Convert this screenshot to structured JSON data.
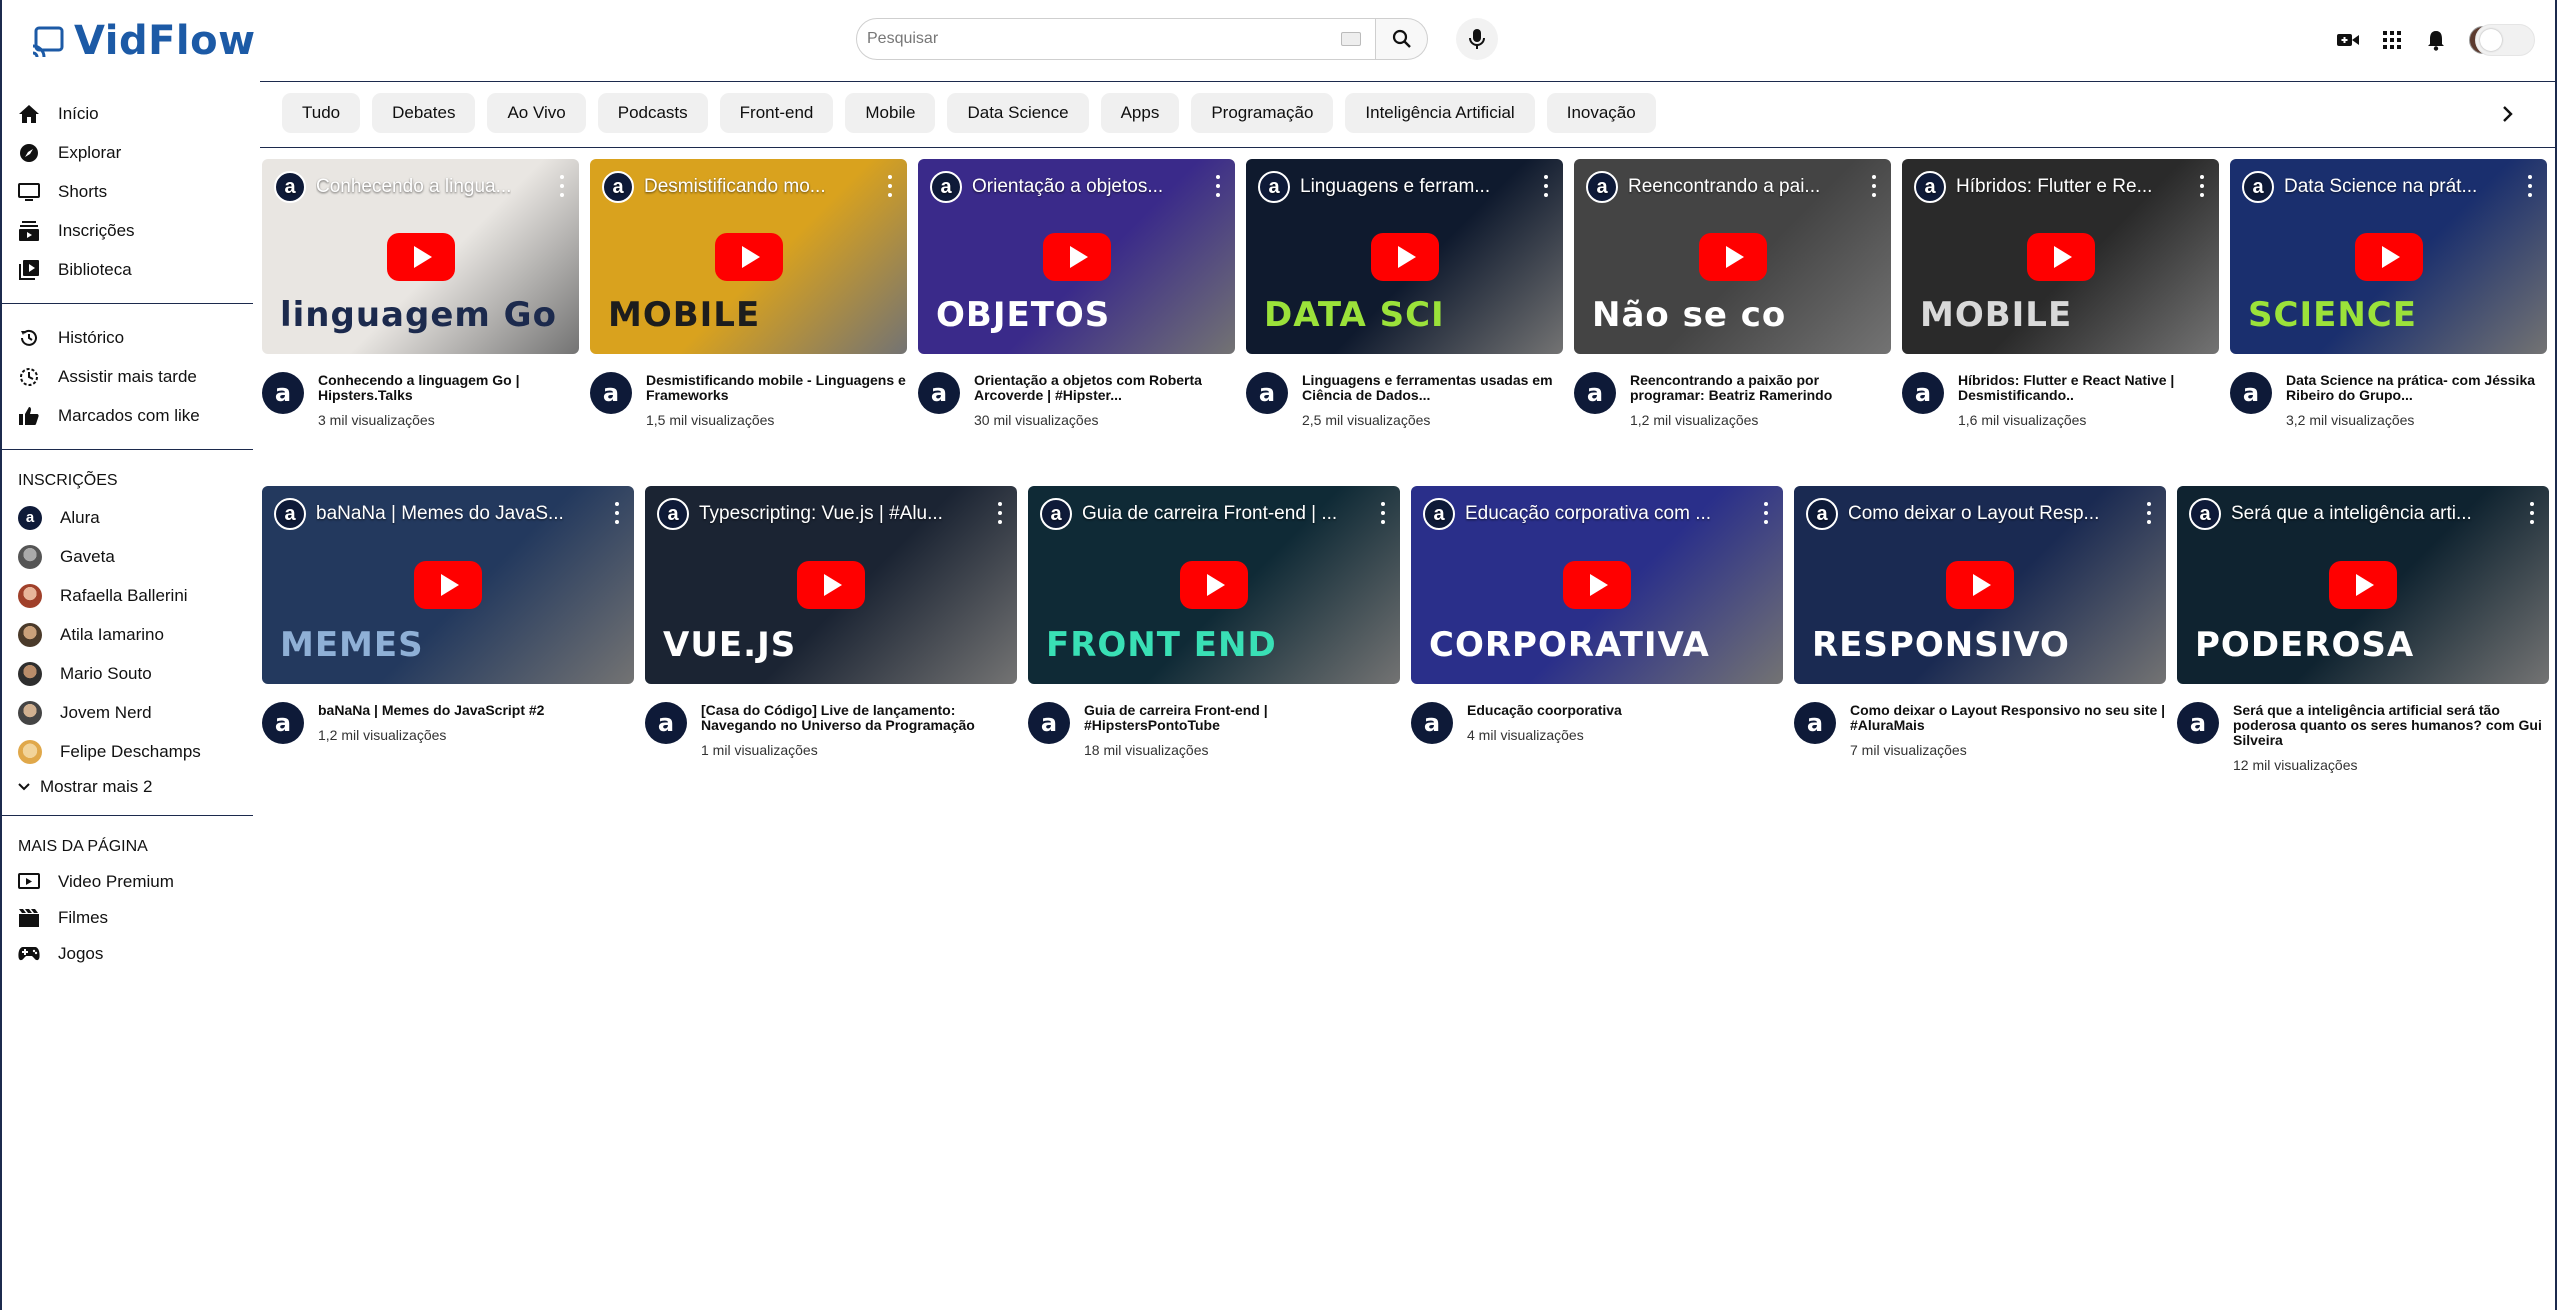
{
  "app": {
    "name": "VidFlow",
    "brand_color": "#1c5aa6"
  },
  "search": {
    "placeholder": "Pesquisar"
  },
  "header_icons": [
    "create-video-icon",
    "apps-grid-icon",
    "notifications-bell-icon",
    "user-avatar",
    "theme-toggle"
  ],
  "sidebar": {
    "main": [
      {
        "label": "Início",
        "icon": "home-icon"
      },
      {
        "label": "Explorar",
        "icon": "compass-icon"
      },
      {
        "label": "Shorts",
        "icon": "shorts-icon"
      },
      {
        "label": "Inscrições",
        "icon": "subscriptions-icon"
      },
      {
        "label": "Biblioteca",
        "icon": "library-icon"
      }
    ],
    "personal": [
      {
        "label": "Histórico",
        "icon": "history-icon"
      },
      {
        "label": "Assistir mais tarde",
        "icon": "watch-later-icon"
      },
      {
        "label": "Marcados com like",
        "icon": "thumbs-up-icon"
      }
    ],
    "subscriptions_title": "INSCRIÇÕES",
    "subscriptions": [
      {
        "label": "Alura",
        "color": "#0e1a38"
      },
      {
        "label": "Gaveta",
        "color": "#6b6b6b"
      },
      {
        "label": "Rafaella Ballerini",
        "color": "#b5543a"
      },
      {
        "label": "Atila Iamarino",
        "color": "#5a4a3a"
      },
      {
        "label": "Mario Souto",
        "color": "#3d3d3d"
      },
      {
        "label": "Jovem Nerd",
        "color": "#555555"
      },
      {
        "label": "Felipe Deschamps",
        "color": "#e0a84a"
      }
    ],
    "show_more": "Mostrar mais 2",
    "more_title": "MAIS DA PÁGINA",
    "more": [
      {
        "label": "Video Premium",
        "icon": "premium-play-icon"
      },
      {
        "label": "Filmes",
        "icon": "clapperboard-icon"
      },
      {
        "label": "Jogos",
        "icon": "gamepad-icon"
      }
    ]
  },
  "chips": [
    "Tudo",
    "Debates",
    "Ao Vivo",
    "Podcasts",
    "Front-end",
    "Mobile",
    "Data Science",
    "Apps",
    "Programação",
    "Inteligência Artificial",
    "Inovação"
  ],
  "videos_row1": [
    {
      "overlay": "Conhecendo a lingua...",
      "title": "Conhecendo a linguagem Go | Hipsters.Talks",
      "views": "3 mil visualizações",
      "bg": "#e9e6e2",
      "accent": "#1c2a4d",
      "deco": "linguagem Go"
    },
    {
      "overlay": "Desmistificando mo...",
      "title": "Desmistificando mobile - Linguagens e Frameworks",
      "views": "1,5 mil visualizações",
      "bg": "#d9a21e",
      "accent": "#1d1d1d",
      "deco": "MOBILE"
    },
    {
      "overlay": "Orientação a objetos...",
      "title": "Orientação a objetos com Roberta Arcoverde | #Hipster...",
      "views": "30 mil visualizações",
      "bg": "#3a2a8a",
      "accent": "#ffffff",
      "deco": "OBJETOS"
    },
    {
      "overlay": "Linguagens e ferram...",
      "title": "Linguagens e ferramentas usadas em Ciência de Dados...",
      "views": "2,5 mil visualizações",
      "bg": "#0f1a2e",
      "accent": "#9be23a",
      "deco": "DATA SCI"
    },
    {
      "overlay": "Reencontrando a pai...",
      "title": "Reencontrando a paixão por programar: Beatriz Ramerindo",
      "views": "1,2 mil visualizações",
      "bg": "#444444",
      "accent": "#ffffff",
      "deco": "Não se co"
    },
    {
      "overlay": "Híbridos: Flutter e Re...",
      "title": "Híbridos: Flutter e React Native | Desmistificando..",
      "views": "1,6 mil visualizações",
      "bg": "#2a2a2a",
      "accent": "#d9d9d9",
      "deco": "MOBILE"
    },
    {
      "overlay": "Data Science na prát...",
      "title": "Data Science na prática- com Jéssika Ribeiro do Grupo...",
      "views": "3,2 mil visualizações",
      "bg": "#1a2f6e",
      "accent": "#9be23a",
      "deco": "SCIENCE"
    }
  ],
  "videos_row2": [
    {
      "overlay": "baNaNa | Memes do JavaS...",
      "title": "baNaNa | Memes do JavaScript #2",
      "views": "1,2 mil visualizações",
      "bg": "#23395e",
      "accent": "#8fb0d6",
      "deco": "MEMES"
    },
    {
      "overlay": "Typescripting: Vue.js | #Alu...",
      "title": "[Casa do Código] Live de lançamento: Navegando no Universo da Programação",
      "views": "1 mil visualizações",
      "bg": "#1b2433",
      "accent": "#ffffff",
      "deco": "VUE.JS"
    },
    {
      "overlay": "Guia de carreira Front-end | ...",
      "title": "Guia de carreira Front-end | #HipstersPontoTube",
      "views": "18 mil visualizações",
      "bg": "#0f2a36",
      "accent": "#39e0b5",
      "deco": "FRONT END"
    },
    {
      "overlay": "Educação corporativa com ...",
      "title": "Educação coorporativa",
      "views": "4 mil visualizações",
      "bg": "#2a2f8a",
      "accent": "#ffffff",
      "deco": "CORPORATIVA"
    },
    {
      "overlay": "Como deixar o Layout Resp...",
      "title": "Como deixar o Layout Responsivo no seu site | #AluraMais",
      "views": "7 mil visualizações",
      "bg": "#1a2a52",
      "accent": "#ffffff",
      "deco": "RESPONSIVO"
    },
    {
      "overlay": "Será que a inteligência arti...",
      "title": "Será que a inteligência artificial será tão poderosa quanto os seres humanos? com Gui Silveira",
      "views": "12 mil visualizações",
      "bg": "#0f2330",
      "accent": "#ffffff",
      "deco": "PODEROSA"
    }
  ]
}
